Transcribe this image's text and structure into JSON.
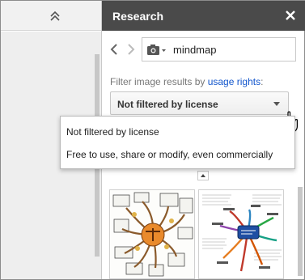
{
  "panel": {
    "title": "Research"
  },
  "search": {
    "query": "mindmap"
  },
  "filter": {
    "prefix": "Filter image results by ",
    "link": "usage rights",
    "suffix": ":",
    "selected": "Not filtered by license"
  },
  "menu": {
    "options": [
      "Not filtered by license",
      "Free to use, share or modify, even commercially"
    ]
  },
  "icons": {
    "collapse": "double-chevron-up-icon",
    "close": "close-icon",
    "back": "chevron-left-icon",
    "forward": "chevron-right-icon",
    "camera": "camera-icon",
    "dropdown": "triangle-down-icon",
    "cursor": "hand-pointer-icon",
    "scroll_up": "triangle-up-icon"
  },
  "colors": {
    "header_bg": "#4a4a4a",
    "link": "#1155cc"
  }
}
